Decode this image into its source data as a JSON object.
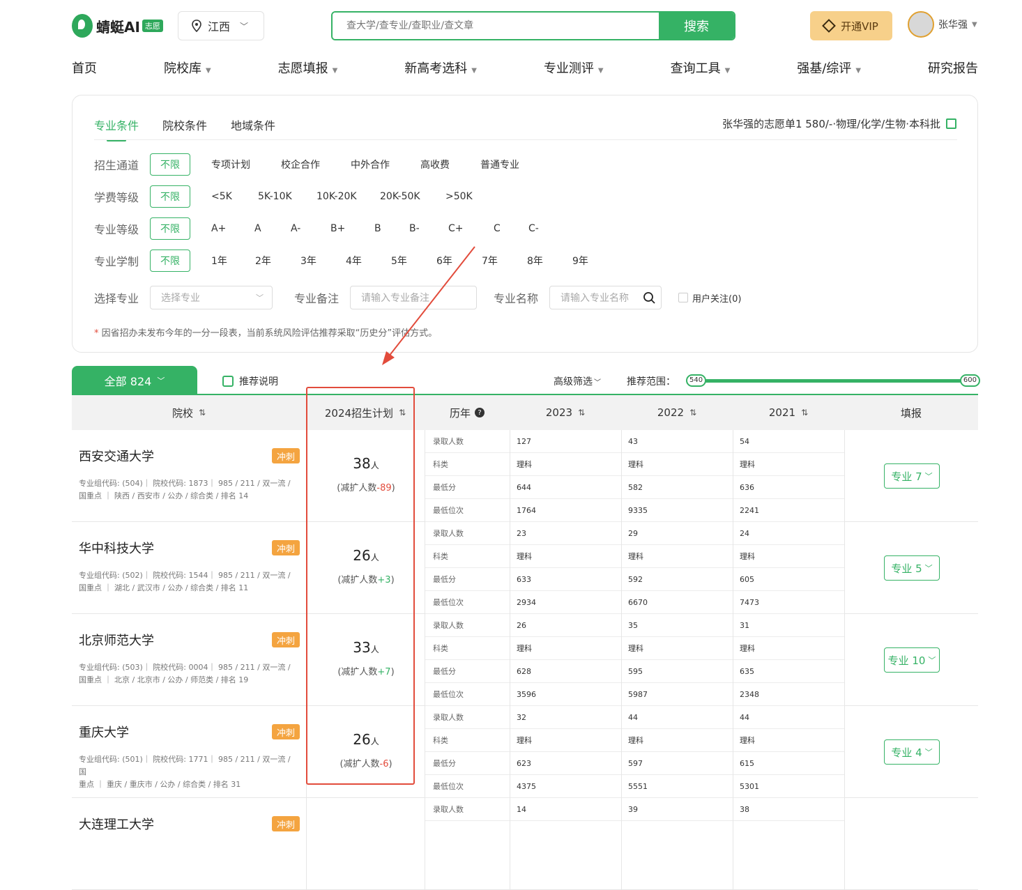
{
  "header": {
    "brand": "蜻蜓AI",
    "brand_tag": "志愿",
    "region": "江西",
    "search_placeholder": "查大学/查专业/查职业/查文章",
    "search_button": "搜索",
    "vip_button": "开通VIP",
    "user_name": "张华强"
  },
  "nav": [
    {
      "label": "首页",
      "caret": false
    },
    {
      "label": "院校库",
      "caret": true
    },
    {
      "label": "志愿填报",
      "caret": true
    },
    {
      "label": "新高考选科",
      "caret": true
    },
    {
      "label": "专业测评",
      "caret": true
    },
    {
      "label": "查询工具",
      "caret": true
    },
    {
      "label": "强基/综评",
      "caret": true
    },
    {
      "label": "研究报告",
      "caret": false
    }
  ],
  "filter": {
    "tabs": [
      "专业条件",
      "院校条件",
      "地域条件"
    ],
    "plan_info": "张华强的志愿单1  580/-·物理/化学/生物·本科批",
    "rows": [
      {
        "label": "招生通道",
        "selected": "不限",
        "options": [
          "专项计划",
          "校企合作",
          "中外合作",
          "高收费",
          "普通专业"
        ]
      },
      {
        "label": "学费等级",
        "selected": "不限",
        "options": [
          "<5K",
          "5K-10K",
          "10K-20K",
          "20K-50K",
          ">50K"
        ]
      },
      {
        "label": "专业等级",
        "selected": "不限",
        "options": [
          "A+",
          "A",
          "A-",
          "B+",
          "B",
          "B-",
          "C+",
          "C",
          "C-"
        ]
      },
      {
        "label": "专业学制",
        "selected": "不限",
        "options": [
          "1年",
          "2年",
          "3年",
          "4年",
          "5年",
          "6年",
          "7年",
          "8年",
          "9年"
        ]
      }
    ],
    "select_major_label": "选择专业",
    "select_major_placeholder": "选择专业",
    "major_note_label": "专业备注",
    "major_note_placeholder": "请输入专业备注",
    "major_name_label": "专业名称",
    "major_name_placeholder": "请输入专业名称",
    "user_follow": "用户关注(0)",
    "note_star": "*",
    "note": "因省招办未发布今年的一分一段表，当前系统风险评估推荐采取“历史分”评估方式。"
  },
  "toolbar": {
    "all_tab": "全部 824",
    "recommend_note": "推荐说明",
    "advanced_filter": "高级筛选",
    "range_label": "推荐范围：",
    "range_min": "540",
    "range_max": "600"
  },
  "table": {
    "headers": {
      "school": "院校",
      "plan": "2024招生计划",
      "history": "历年",
      "y2023": "2023",
      "y2022": "2022",
      "y2021": "2021",
      "fill": "填报"
    },
    "row_labels": [
      "录取人数",
      "科类",
      "最低分",
      "最低位次"
    ],
    "schools": [
      {
        "name": "西安交通大学",
        "badge": "冲刺",
        "meta1": "专业组代码: (504)｜  院校代码: 1873｜  985 / 211 / 双一流 /",
        "meta2": "国重点  ｜  陕西 / 西安市 / 公办 / 综合类 / 排名 14",
        "plan": "38",
        "unit": "人",
        "change_prefix": "(减扩人数",
        "change": "-89",
        "change_suffix": ")",
        "change_sign": "neg",
        "data": [
          [
            "127",
            "43",
            "54"
          ],
          [
            "理科",
            "理科",
            "理科"
          ],
          [
            "644",
            "582",
            "636"
          ],
          [
            "1764",
            "9335",
            "2241"
          ]
        ],
        "fill": "专业 7"
      },
      {
        "name": "华中科技大学",
        "badge": "冲刺",
        "meta1": "专业组代码: (502)｜  院校代码: 1544｜  985 / 211 / 双一流 /",
        "meta2": "国重点  ｜  湖北 / 武汉市 / 公办 / 综合类 / 排名 11",
        "plan": "26",
        "unit": "人",
        "change_prefix": "(减扩人数",
        "change": "+3",
        "change_suffix": ")",
        "change_sign": "pos",
        "data": [
          [
            "23",
            "29",
            "24"
          ],
          [
            "理科",
            "理科",
            "理科"
          ],
          [
            "633",
            "592",
            "605"
          ],
          [
            "2934",
            "6670",
            "7473"
          ]
        ],
        "fill": "专业 5"
      },
      {
        "name": "北京师范大学",
        "badge": "冲刺",
        "meta1": "专业组代码: (503)｜  院校代码: 0004｜  985 / 211 / 双一流 /",
        "meta2": "国重点  ｜  北京 / 北京市 / 公办 / 师范类 / 排名 19",
        "plan": "33",
        "unit": "人",
        "change_prefix": "(减扩人数",
        "change": "+7",
        "change_suffix": ")",
        "change_sign": "pos",
        "data": [
          [
            "26",
            "35",
            "31"
          ],
          [
            "理科",
            "理科",
            "理科"
          ],
          [
            "628",
            "595",
            "635"
          ],
          [
            "3596",
            "5987",
            "2348"
          ]
        ],
        "fill": "专业 10"
      },
      {
        "name": "重庆大学",
        "badge": "冲刺",
        "meta1": "专业组代码: (501)｜  院校代码: 1771｜  985 / 211 / 双一流 / 国",
        "meta2": "重点  ｜  重庆 / 重庆市 / 公办 / 综合类 / 排名 31",
        "plan": "26",
        "unit": "人",
        "change_prefix": "(减扩人数",
        "change": "-6",
        "change_suffix": ")",
        "change_sign": "neg",
        "data": [
          [
            "32",
            "44",
            "44"
          ],
          [
            "理科",
            "理科",
            "理科"
          ],
          [
            "623",
            "597",
            "615"
          ],
          [
            "4375",
            "5551",
            "5301"
          ]
        ],
        "fill": "专业 4"
      },
      {
        "name": "大连理工大学",
        "badge": "冲刺",
        "meta1": "",
        "meta2": "",
        "plan": "",
        "unit": "",
        "change_prefix": "",
        "change": "",
        "change_suffix": "",
        "change_sign": "",
        "data": [
          [
            "14",
            "39",
            "38"
          ]
        ],
        "fill": ""
      }
    ]
  }
}
